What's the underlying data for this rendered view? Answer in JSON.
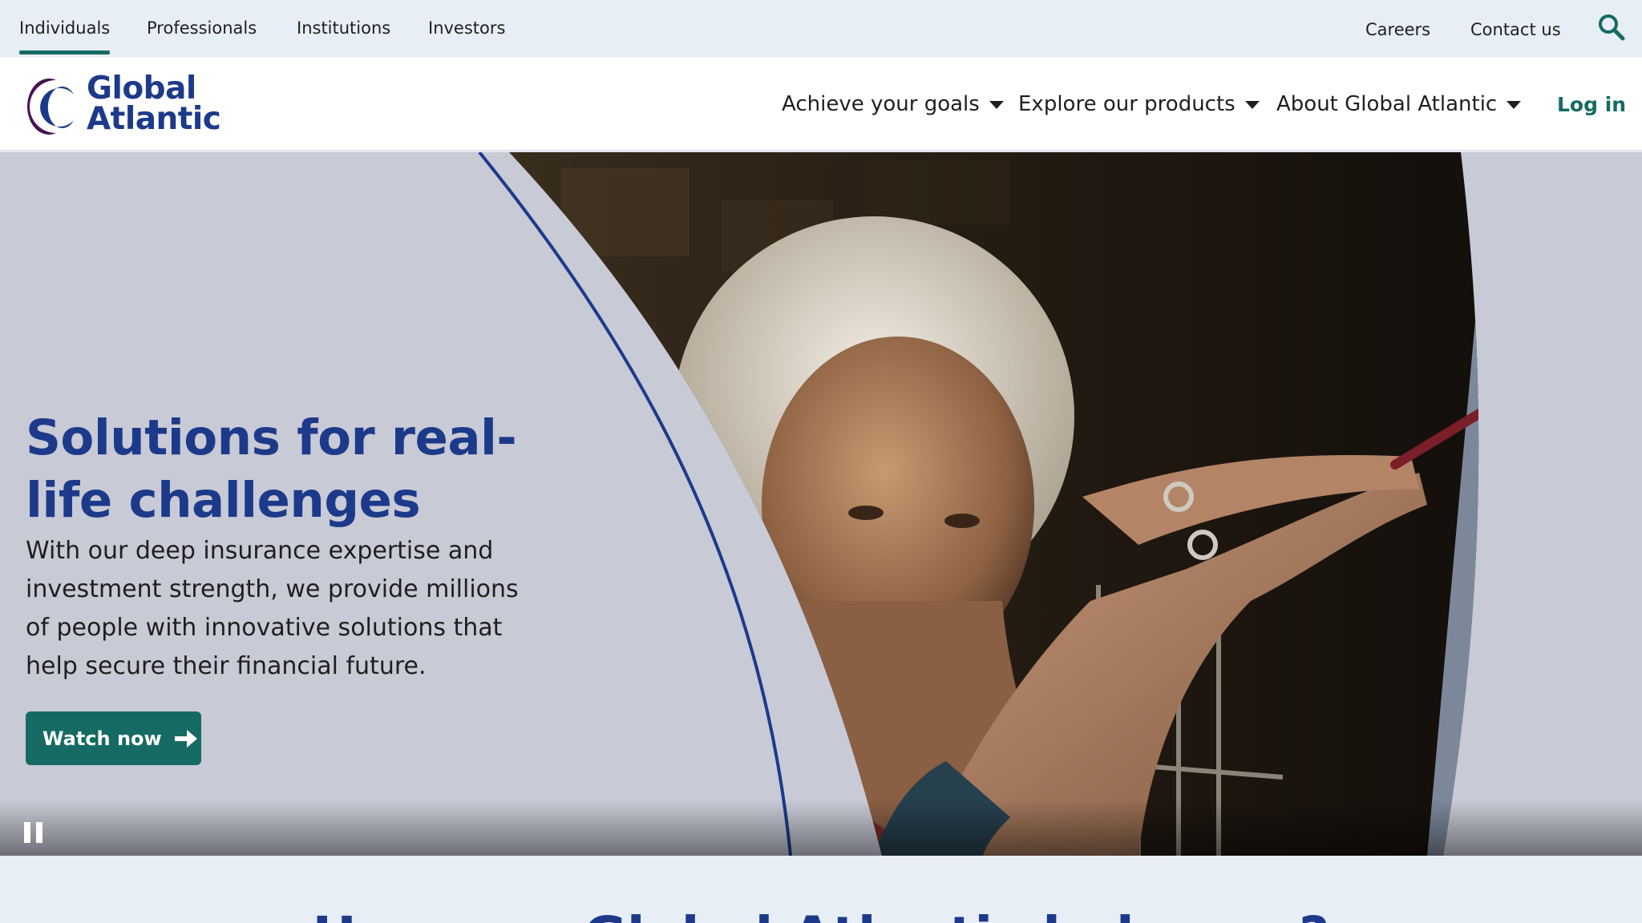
{
  "utility_nav": {
    "tabs": [
      {
        "label": "Individuals",
        "active": true
      },
      {
        "label": "Professionals",
        "active": false
      },
      {
        "label": "Institutions",
        "active": false
      },
      {
        "label": "Investors",
        "active": false
      }
    ],
    "careers": "Careers",
    "contact": "Contact us",
    "search_icon": "search-icon"
  },
  "header": {
    "logo_line1": "Global",
    "logo_line2": "Atlantic",
    "nav": [
      {
        "label": "Achieve your goals"
      },
      {
        "label": "Explore our products"
      },
      {
        "label": "About Global Atlantic"
      }
    ],
    "login": "Log in"
  },
  "hero": {
    "title": "Solutions for real-life challenges",
    "body": "With our deep insurance expertise and investment strength, we provide millions of people with innovative solutions that help secure their financial future.",
    "cta": "Watch now",
    "cta_icon": "arrow-right-icon",
    "pause_icon": "pause-icon"
  },
  "next_section": {
    "title": "How can Global Atlantic help you?"
  },
  "colors": {
    "brand_navy": "#1d3a8a",
    "brand_teal": "#156b63",
    "logo_purple": "#4a1356",
    "hero_bg": "#c8cad6",
    "page_bg": "#e8eef6"
  }
}
